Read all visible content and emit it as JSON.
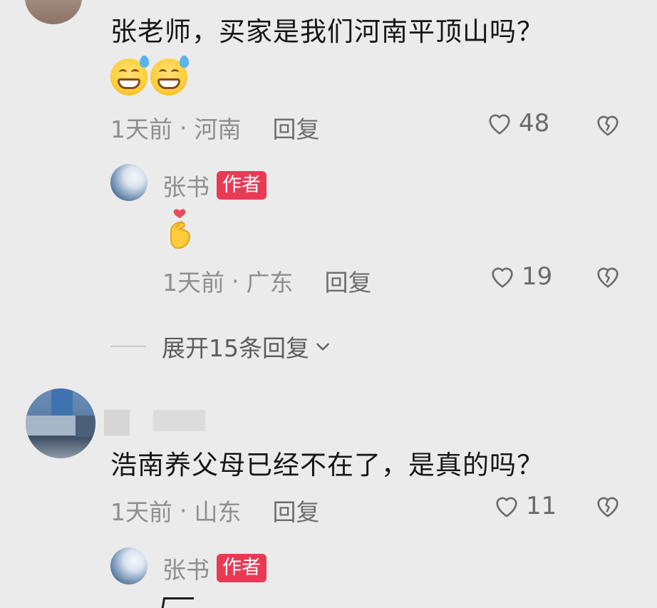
{
  "comments": [
    {
      "text": "张老师，买家是我们河南平顶山吗？",
      "time": "1天前",
      "location": "河南",
      "reply_label": "回复",
      "likes": "48",
      "emoji": [
        "grinning-sweat-face-emoji",
        "grinning-sweat-face-emoji"
      ],
      "author_reply": {
        "name": "张书",
        "badge": "作者",
        "emoji": "finger-heart-emoji",
        "time": "1天前",
        "location": "广东",
        "reply_label": "回复",
        "likes": "19"
      },
      "expand_label": "展开15条回复"
    },
    {
      "text": "浩南养父母已经不在了，是真的吗？",
      "time": "1天前",
      "location": "山东",
      "reply_label": "回复",
      "likes": "11",
      "author_reply": {
        "name": "张书",
        "badge": "作者"
      }
    }
  ],
  "meta_separator": "·",
  "colors": {
    "background": "#ebebeb",
    "author_badge": "#e83a55",
    "meta_text": "#8e8e8e"
  },
  "icons": [
    "heart-outline-icon",
    "broken-heart-icon",
    "chevron-down-icon"
  ]
}
